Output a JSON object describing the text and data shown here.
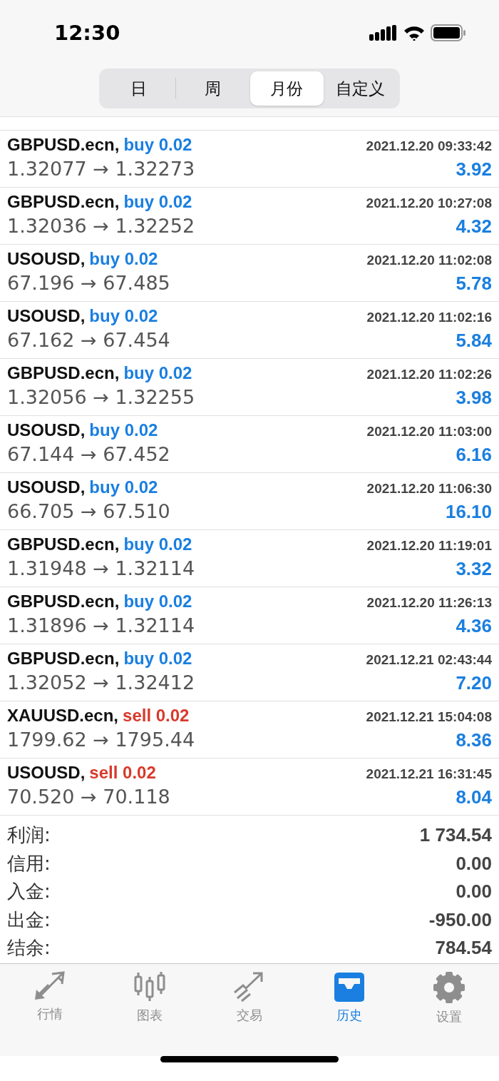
{
  "status_bar": {
    "time": "12:30"
  },
  "period_tabs": [
    {
      "label": "日",
      "selected": false
    },
    {
      "label": "周",
      "selected": false
    },
    {
      "label": "月份",
      "selected": true
    },
    {
      "label": "自定义",
      "selected": false
    }
  ],
  "deals": [
    {
      "symbol": "GBPUSD.ecn,",
      "kind": "buy",
      "side_text": "buy 0.02",
      "time": "2021.12.20 09:33:42",
      "prices": "1.32077 → 1.32273",
      "profit": "3.92"
    },
    {
      "symbol": "GBPUSD.ecn,",
      "kind": "buy",
      "side_text": "buy 0.02",
      "time": "2021.12.20 10:27:08",
      "prices": "1.32036 → 1.32252",
      "profit": "4.32"
    },
    {
      "symbol": "USOUSD,",
      "kind": "buy",
      "side_text": "buy 0.02",
      "time": "2021.12.20 11:02:08",
      "prices": "67.196 → 67.485",
      "profit": "5.78"
    },
    {
      "symbol": "USOUSD,",
      "kind": "buy",
      "side_text": "buy 0.02",
      "time": "2021.12.20 11:02:16",
      "prices": "67.162 → 67.454",
      "profit": "5.84"
    },
    {
      "symbol": "GBPUSD.ecn,",
      "kind": "buy",
      "side_text": "buy 0.02",
      "time": "2021.12.20 11:02:26",
      "prices": "1.32056 → 1.32255",
      "profit": "3.98"
    },
    {
      "symbol": "USOUSD,",
      "kind": "buy",
      "side_text": "buy 0.02",
      "time": "2021.12.20 11:03:00",
      "prices": "67.144 → 67.452",
      "profit": "6.16"
    },
    {
      "symbol": "USOUSD,",
      "kind": "buy",
      "side_text": "buy 0.02",
      "time": "2021.12.20 11:06:30",
      "prices": "66.705 → 67.510",
      "profit": "16.10"
    },
    {
      "symbol": "GBPUSD.ecn,",
      "kind": "buy",
      "side_text": "buy 0.02",
      "time": "2021.12.20 11:19:01",
      "prices": "1.31948 → 1.32114",
      "profit": "3.32"
    },
    {
      "symbol": "GBPUSD.ecn,",
      "kind": "buy",
      "side_text": "buy 0.02",
      "time": "2021.12.20 11:26:13",
      "prices": "1.31896 → 1.32114",
      "profit": "4.36"
    },
    {
      "symbol": "GBPUSD.ecn,",
      "kind": "buy",
      "side_text": "buy 0.02",
      "time": "2021.12.21 02:43:44",
      "prices": "1.32052 → 1.32412",
      "profit": "7.20"
    },
    {
      "symbol": "XAUUSD.ecn,",
      "kind": "sell",
      "side_text": "sell 0.02",
      "time": "2021.12.21 15:04:08",
      "prices": "1799.62 → 1795.44",
      "profit": "8.36"
    },
    {
      "symbol": "USOUSD,",
      "kind": "sell",
      "side_text": "sell 0.02",
      "time": "2021.12.21 16:31:45",
      "prices": "70.520 → 70.118",
      "profit": "8.04"
    }
  ],
  "summary": [
    {
      "label": "利润:",
      "value": "1 734.54"
    },
    {
      "label": "信用:",
      "value": "0.00"
    },
    {
      "label": "入金:",
      "value": "0.00"
    },
    {
      "label": "出金:",
      "value": "-950.00"
    },
    {
      "label": "结余:",
      "value": "784.54"
    }
  ],
  "tab_bar": [
    {
      "label": "行情",
      "kind": "quotes",
      "selected": false
    },
    {
      "label": "图表",
      "kind": "chart",
      "selected": false
    },
    {
      "label": "交易",
      "kind": "trade",
      "selected": false
    },
    {
      "label": "历史",
      "kind": "history",
      "selected": true
    },
    {
      "label": "设置",
      "kind": "settings",
      "selected": false
    }
  ]
}
